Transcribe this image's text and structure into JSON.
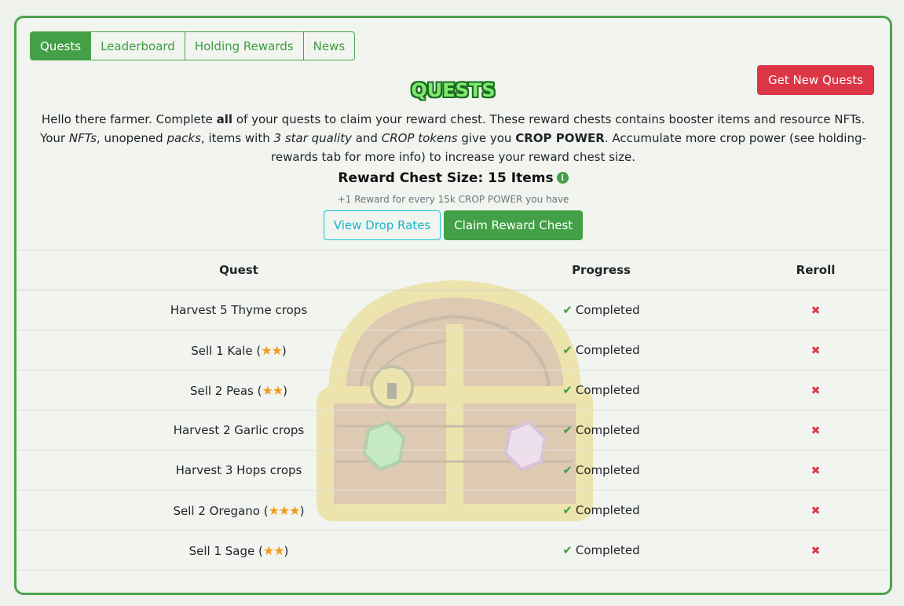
{
  "tabs": [
    {
      "label": "Quests",
      "active": true
    },
    {
      "label": "Leaderboard",
      "active": false
    },
    {
      "label": "Holding Rewards",
      "active": false
    },
    {
      "label": "News",
      "active": false
    }
  ],
  "header": {
    "title": "QUESTS",
    "get_new_quests": "Get New Quests"
  },
  "intro": {
    "p1": "Hello there farmer. Complete ",
    "p1_bold": "all",
    "p2": " of your quests to claim your reward chest. These reward chests contains booster items and resource NFTs. Your ",
    "nfts": "NFTs",
    "p3": ", unopened ",
    "packs": "packs",
    "p4": ", items with ",
    "star_quality": "3 star quality",
    "p5": " and ",
    "crop_tokens": "CROP tokens",
    "p6": " give you ",
    "crop_power": "CROP POWER",
    "p7": ". Accumulate more crop power (see holding-rewards tab for more info) to increase your reward chest size."
  },
  "reward": {
    "size_label": "Reward Chest Size: 15 Items",
    "info_icon": "i",
    "subtext": "+1 Reward for every 15k CROP POWER you have",
    "view_drop_rates": "View Drop Rates",
    "claim": "Claim Reward Chest"
  },
  "table": {
    "headers": [
      "Quest",
      "Progress",
      "Reroll"
    ],
    "rows": [
      {
        "quest": "Harvest 5 Thyme crops",
        "stars": "",
        "progress": "Completed"
      },
      {
        "quest": "Sell 1 Kale (",
        "stars": "★★",
        "suffix": ")",
        "progress": "Completed"
      },
      {
        "quest": "Sell 2 Peas (",
        "stars": "★★",
        "suffix": ")",
        "progress": "Completed"
      },
      {
        "quest": "Harvest 2 Garlic crops",
        "stars": "",
        "progress": "Completed"
      },
      {
        "quest": "Harvest 3 Hops crops",
        "stars": "",
        "progress": "Completed"
      },
      {
        "quest": "Sell 2 Oregano (",
        "stars": "★★★",
        "suffix": ")",
        "progress": "Completed"
      },
      {
        "quest": "Sell 1 Sage (",
        "stars": "★★",
        "suffix": ")",
        "progress": "Completed"
      }
    ],
    "check_icon": "✔",
    "reroll_icon": "✖"
  },
  "colors": {
    "accent": "#43a046",
    "danger": "#dc3545",
    "info": "#17c3d6",
    "star": "#f29a1c"
  }
}
